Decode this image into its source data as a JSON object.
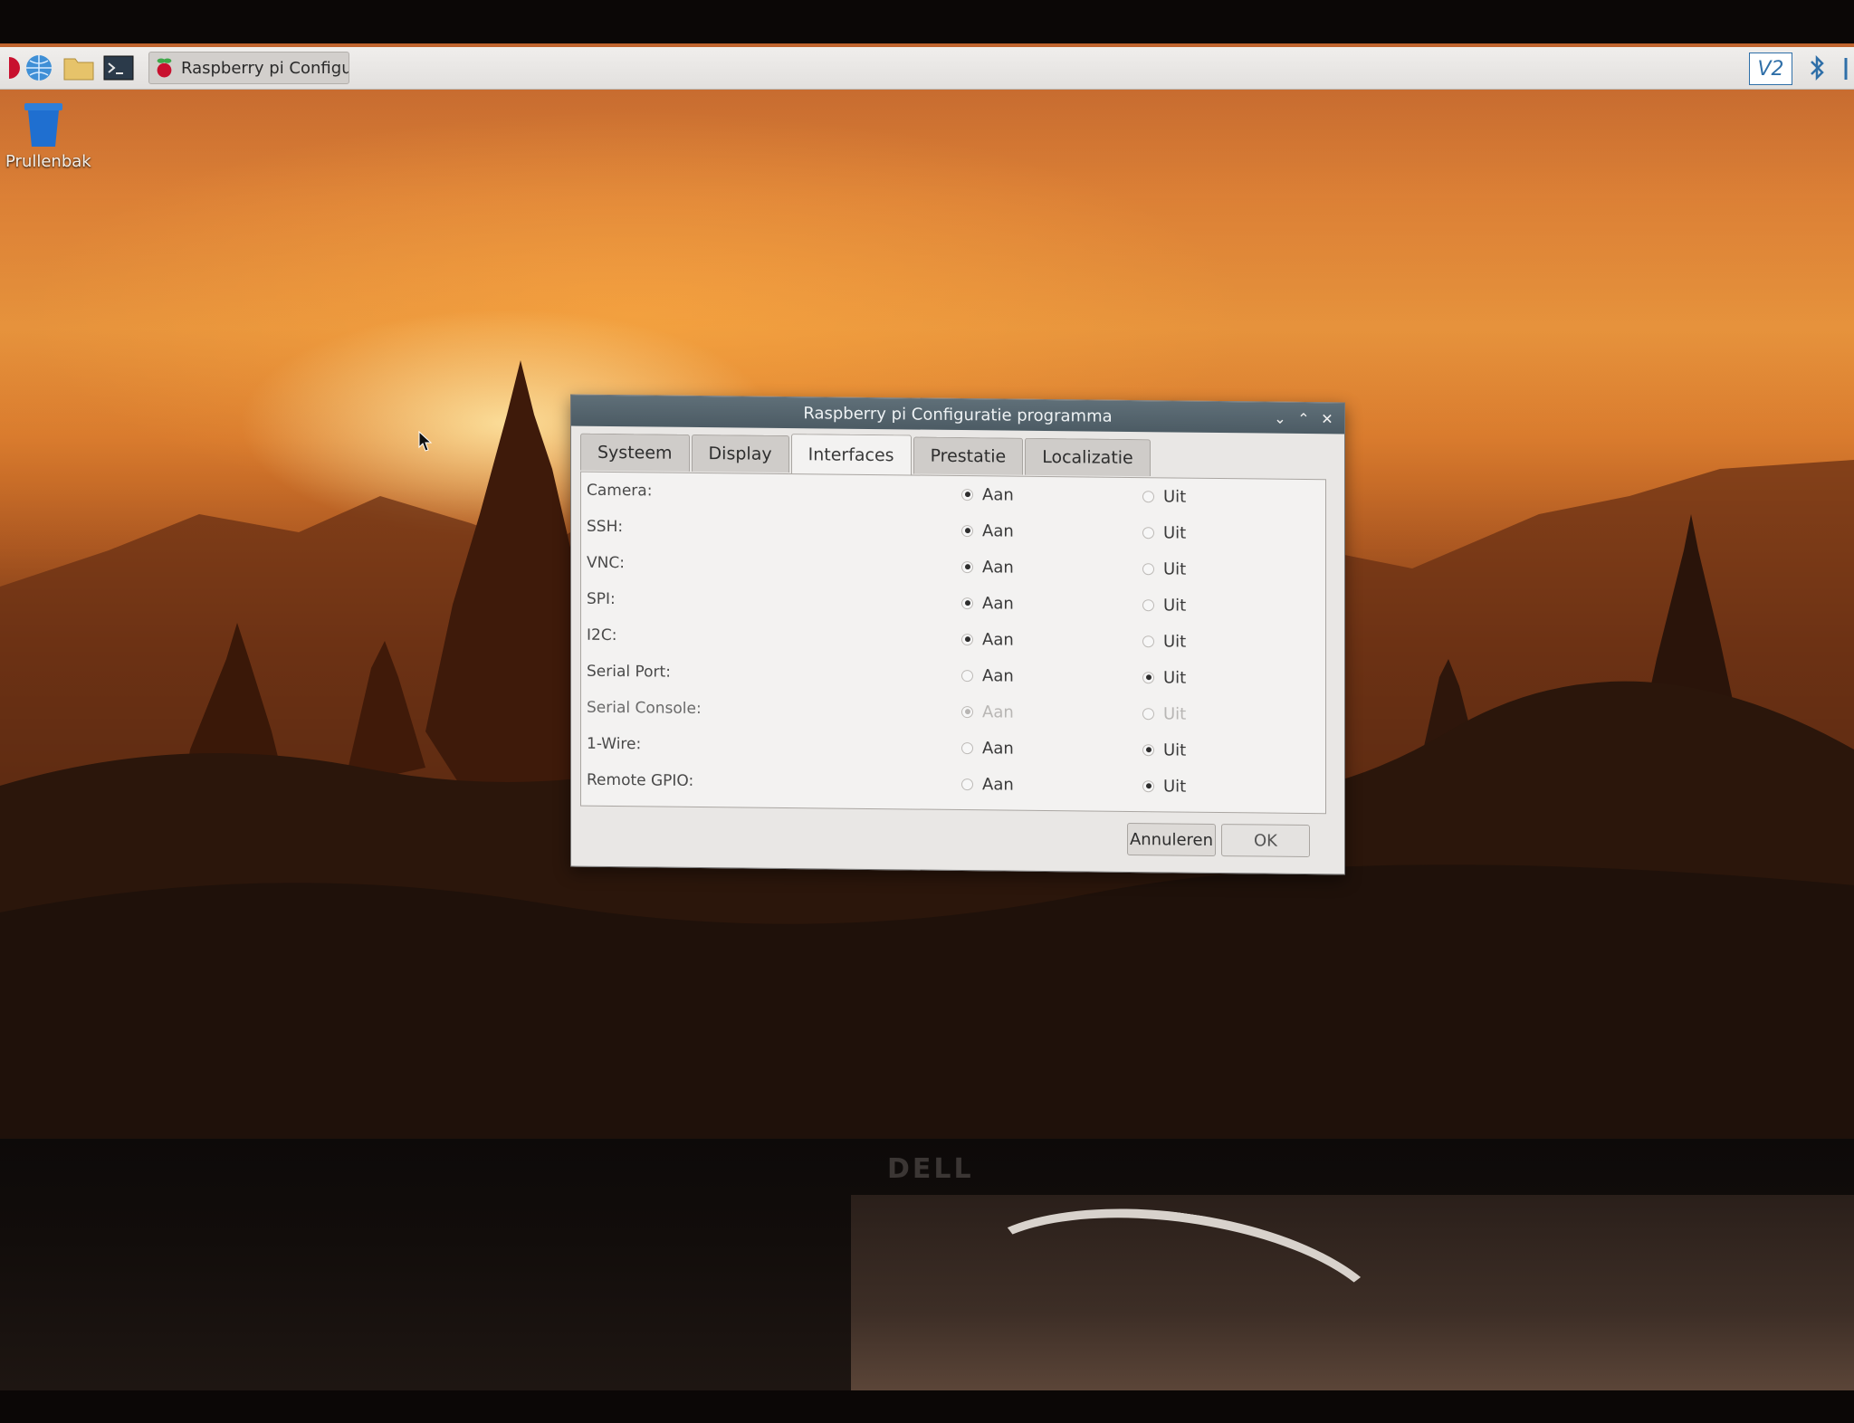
{
  "taskbar": {
    "icons": [
      "raspberry-menu-icon",
      "browser-globe-icon",
      "file-manager-folder-icon",
      "terminal-icon"
    ],
    "task_label": "Raspberry pi Configur...",
    "tray": [
      "vnc-icon",
      "bluetooth-icon"
    ]
  },
  "desktop": {
    "trash_label": "Prullenbak"
  },
  "dialog": {
    "title": "Raspberry pi Configuratie programma",
    "tabs": [
      {
        "label": "Systeem"
      },
      {
        "label": "Display"
      },
      {
        "label": "Interfaces",
        "active": true
      },
      {
        "label": "Prestatie"
      },
      {
        "label": "Localizatie"
      }
    ],
    "on_label": "Aan",
    "off_label": "Uit",
    "rows": [
      {
        "label": "Camera:",
        "value": "on"
      },
      {
        "label": "SSH:",
        "value": "on"
      },
      {
        "label": "VNC:",
        "value": "on"
      },
      {
        "label": "SPI:",
        "value": "on"
      },
      {
        "label": "I2C:",
        "value": "on"
      },
      {
        "label": "Serial Port:",
        "value": "off"
      },
      {
        "label": "Serial Console:",
        "value": "on",
        "disabled": true
      },
      {
        "label": "1-Wire:",
        "value": "off"
      },
      {
        "label": "Remote GPIO:",
        "value": "off"
      }
    ],
    "cancel_label": "Annuleren",
    "ok_label": "OK"
  },
  "monitor": {
    "brand": "DELL"
  },
  "colors": {
    "titlebar": "#56656e",
    "sky_orange": "#e58f36",
    "dialog_bg": "#e9e7e5"
  }
}
